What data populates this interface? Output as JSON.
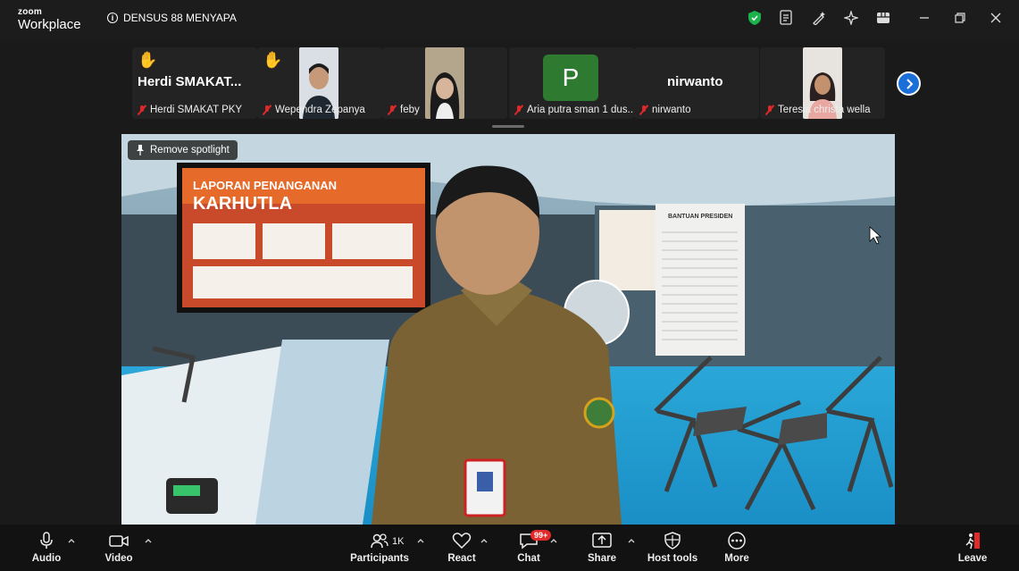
{
  "app": {
    "brand_top": "zoom",
    "brand_bottom": "Workplace"
  },
  "meeting": {
    "title": "DENSUS 88 MENYAPA"
  },
  "gallery": {
    "tiles": [
      {
        "display_name": "Herdi  SMAKAT...",
        "label": "Herdi SMAKAT PKY",
        "hand_raised": true
      },
      {
        "label": "Wependra Zepanya",
        "hand_raised": true
      },
      {
        "label": "feby"
      },
      {
        "avatar_letter": "P",
        "label": "Aria putra sman 1 dus..."
      },
      {
        "display_name": "nirwanto",
        "label": "nirwanto"
      },
      {
        "label": "Teresia christa wella"
      }
    ]
  },
  "spotlight": {
    "button_label": "Remove spotlight"
  },
  "scene": {
    "banner_line1": "LAPORAN PENANGANAN",
    "banner_line2": "KARHUTLA",
    "board_title": "BANTUAN PRESIDEN"
  },
  "toolbar": {
    "audio": "Audio",
    "video": "Video",
    "participants": "Participants",
    "participants_count": "1K",
    "react": "React",
    "chat": "Chat",
    "chat_badge": "99+",
    "share": "Share",
    "host_tools": "Host tools",
    "more": "More",
    "leave": "Leave"
  },
  "colors": {
    "accent": "#1b6fd8",
    "muted_red": "#e02828",
    "avatar_green": "#2d7a30",
    "leave_red": "#e22a2a"
  }
}
